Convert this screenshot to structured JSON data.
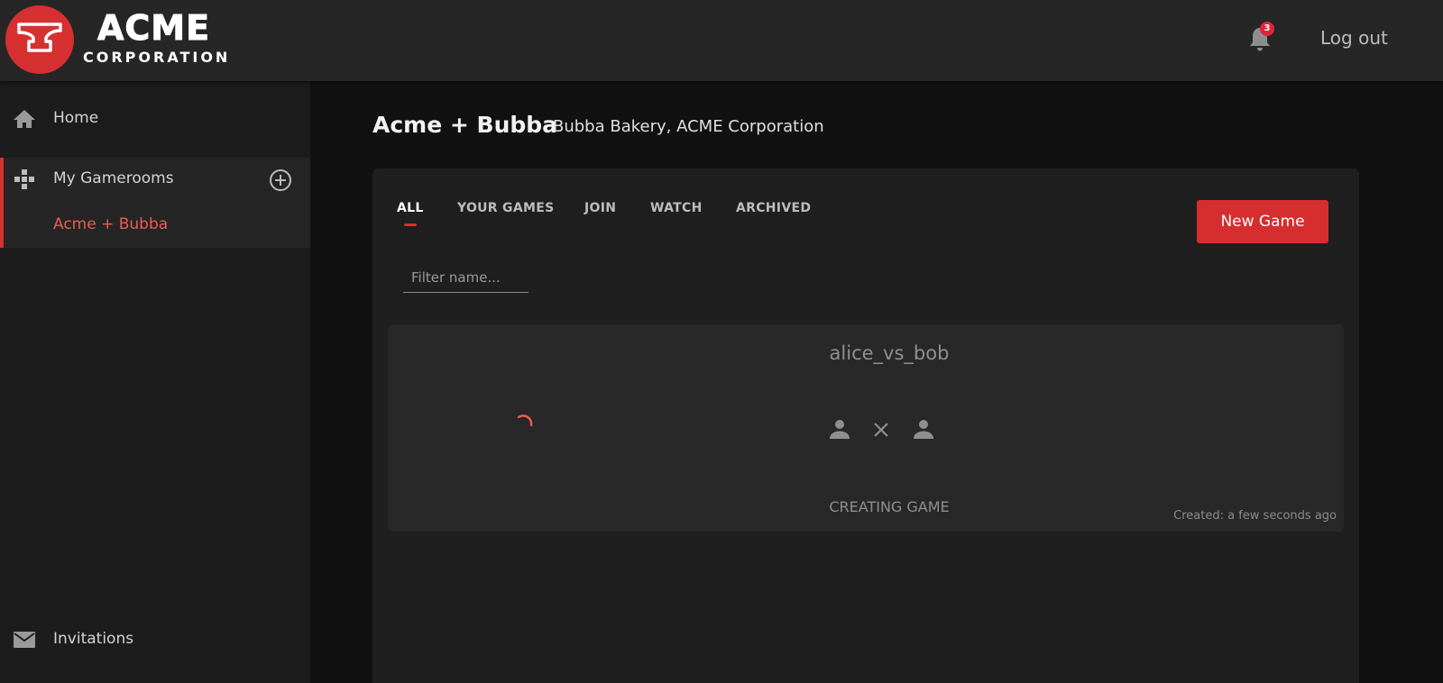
{
  "brand": {
    "name_main": "ACME",
    "name_sub": "CORPORATION",
    "color": "#d63031"
  },
  "header": {
    "notifications_count": "3",
    "logout_label": "Log out"
  },
  "sidebar": {
    "home_label": "Home",
    "gamerooms_label": "My Gamerooms",
    "gamerooms": [
      {
        "label": "Acme + Bubba",
        "active": true
      }
    ],
    "invitations_label": "Invitations"
  },
  "main": {
    "title": "Acme + Bubba",
    "subtitle": "Bubba Bakery, ACME Corporation",
    "tabs": [
      {
        "label": "ALL",
        "active": true
      },
      {
        "label": "YOUR GAMES",
        "active": false
      },
      {
        "label": "JOIN",
        "active": false
      },
      {
        "label": "WATCH",
        "active": false
      },
      {
        "label": "ARCHIVED",
        "active": false
      }
    ],
    "new_game_label": "New Game",
    "filter_placeholder": "Filter name...",
    "games": [
      {
        "name": "alice_vs_bob",
        "status": "CREATING GAME",
        "created": "Created: a few seconds ago"
      }
    ]
  },
  "icons": {
    "logo": "anvil-icon",
    "notifications": "bell-icon",
    "home": "home-icon",
    "gamerooms": "gamepad-icon",
    "add": "plus-circle-icon",
    "invitations": "mail-icon",
    "player": "person-icon",
    "versus": "close-icon",
    "loading": "spinner-icon"
  }
}
